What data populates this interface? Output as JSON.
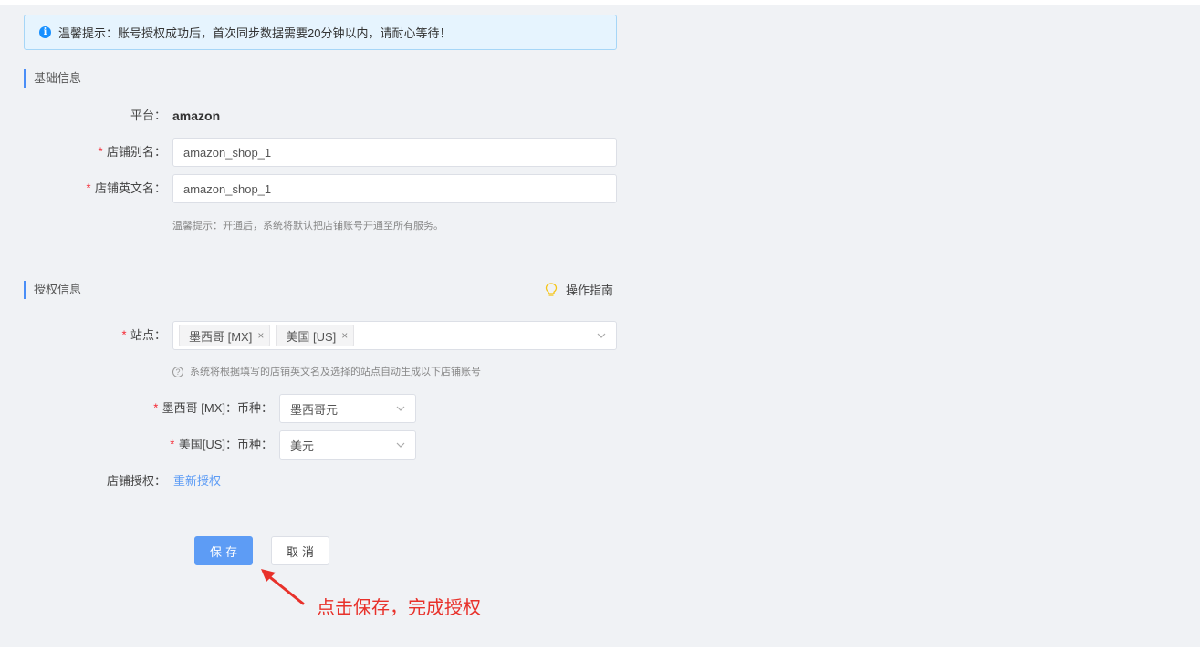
{
  "alert": {
    "text": "温馨提示：账号授权成功后，首次同步数据需要20分钟以内，请耐心等待！"
  },
  "basic": {
    "title": "基础信息",
    "platform_label": "平台：",
    "platform_value": "amazon",
    "alias_label": "店铺别名：",
    "alias_value": "amazon_shop_1",
    "english_name_label": "店铺英文名：",
    "english_name_value": "amazon_shop_1",
    "hint": "温馨提示：开通后，系统将默认把店铺账号开通至所有服务。"
  },
  "auth": {
    "title": "授权信息",
    "guide_label": "操作指南",
    "site_label": "站点：",
    "sites": [
      "墨西哥 [MX]",
      "美国 [US]"
    ],
    "site_hint": "系统将根据填写的店铺英文名及选择的站点自动生成以下店铺账号",
    "mx_currency_label": "墨西哥 [MX]：币种：",
    "mx_currency_value": "墨西哥元",
    "us_currency_label": "美国[US]：币种：",
    "us_currency_value": "美元",
    "shop_auth_label": "店铺授权：",
    "reauth_link": "重新授权"
  },
  "actions": {
    "save_label": "保存",
    "cancel_label": "取消"
  },
  "annotation": {
    "text": "点击保存，完成授权"
  },
  "colors": {
    "primary": "#5d9cf5",
    "required": "#f5222d",
    "annotation": "#e8312a",
    "alert_bg": "#e6f4fe"
  },
  "icons": {
    "alert": "info-icon",
    "guide": "lightbulb-icon",
    "dropdown": "chevron-down-icon",
    "site_hint": "question-circle-icon",
    "tag_remove": "close-icon",
    "annotation": "red-arrow-icon"
  }
}
